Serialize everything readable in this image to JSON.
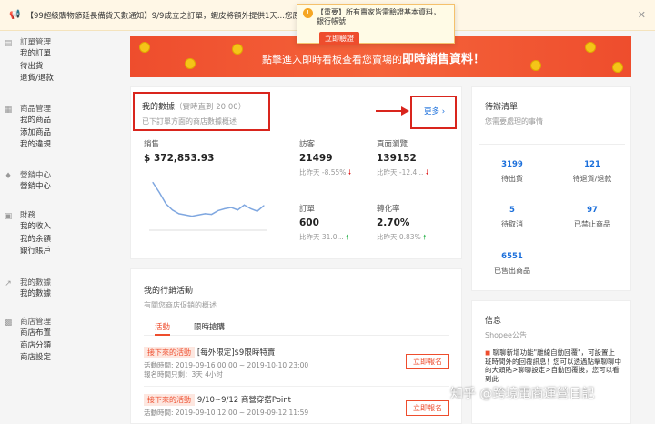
{
  "notice": {
    "text": "【99超級購物節延長備貨天數通知】9/9成立之訂單，蝦皮將額外提供1天...您原本的出貨期限皆會自動再延長1天..."
  },
  "popup": {
    "message": "【重要】所有賣家皆需驗證基本資料，銀行帳號",
    "button": "立即驗證"
  },
  "sidebar": {
    "groups": [
      {
        "icon": "clipboard-icon",
        "title": "訂單管理",
        "items": [
          "我的訂單",
          "待出貨",
          "退貨/退款"
        ]
      },
      {
        "icon": "bag-icon",
        "title": "商品管理",
        "items": [
          "我的商品",
          "添加商品",
          "我的違規"
        ]
      },
      {
        "icon": "tag-icon",
        "title": "營銷中心",
        "items": [
          "營銷中心"
        ]
      },
      {
        "icon": "wallet-icon",
        "title": "財務",
        "items": [
          "我的收入",
          "我的余額",
          "銀行賬戶"
        ]
      },
      {
        "icon": "chart-icon",
        "title": "我的數據",
        "items": [
          "我的數據"
        ]
      },
      {
        "icon": "shop-icon",
        "title": "商店管理",
        "items": [
          "商店布置",
          "商店分類",
          "商店設定"
        ]
      }
    ]
  },
  "banner": {
    "text_prefix": "點擊進入即時看板查看您賣場的",
    "text_bold": "即時銷售資料！"
  },
  "data_card": {
    "title": "我的數據",
    "realtime": "（實時直到 20:00）",
    "subtitle": "已下訂單方面的商店數據概述",
    "more": "更多",
    "sales_label": "銷售",
    "sales_value": "$ 372,853.93",
    "metrics": [
      {
        "label": "訪客",
        "value": "21499",
        "compare": "比昨天 -8.55%",
        "trend": "down"
      },
      {
        "label": "頁面瀏覽",
        "value": "139152",
        "compare": "比昨天 -12.4...",
        "trend": "down"
      },
      {
        "label": "訂單",
        "value": "600",
        "compare": "比昨天 31.0...",
        "trend": "up"
      },
      {
        "label": "轉化率",
        "value": "2.70%",
        "compare": "比昨天 0.83%",
        "trend": "up"
      }
    ]
  },
  "chart_data": {
    "type": "line",
    "title": "",
    "xlabel": "",
    "ylabel": "",
    "x": [
      0,
      1,
      2,
      3,
      4,
      5,
      6,
      7,
      8,
      9,
      10,
      11,
      12,
      13,
      14,
      15,
      16,
      17
    ],
    "series": [
      {
        "values": [
          72,
          56,
          38,
          28,
          22,
          20,
          18,
          20,
          22,
          21,
          27,
          30,
          32,
          28,
          36,
          30,
          26,
          35
        ]
      }
    ],
    "ylim": [
      0,
      80
    ],
    "grid": false,
    "color": "#7fa7e0"
  },
  "todo": {
    "title": "待辦清單",
    "subtitle": "您需要處理的事情",
    "items": [
      {
        "count": "3199",
        "label": "待出貨"
      },
      {
        "count": "121",
        "label": "待退貨/退款"
      },
      {
        "count": "5",
        "label": "待取消"
      },
      {
        "count": "97",
        "label": "已禁止商品"
      },
      {
        "count": "6551",
        "label": "已售出商品"
      }
    ]
  },
  "marketing": {
    "title": "我的行銷活動",
    "subtitle": "有關您商店促銷的概述",
    "tabs": [
      "活動",
      "限時搶購"
    ],
    "promos": [
      {
        "tag": "接下來的活動",
        "name": "[每外限定]$9限時特賣",
        "time": "活動時間: 2019-09-16 00:00 ~ 2019-10-10 23:00",
        "deadline": "報名時間只剩：3天 4小时",
        "button": "立即報名"
      },
      {
        "tag": "接下來的活動",
        "name": "9/10~9/12 商營穿搭Point",
        "time": "活動時間: 2019-09-10 12:00 ~ 2019-09-12 11:59",
        "deadline": "",
        "button": "立即報名"
      }
    ]
  },
  "info": {
    "title": "信息",
    "subtitle": "Shopee公告",
    "text": "聊聊新增功能\"離線自動回覆\"，可設置上班時間外的回覆訊息！您可以透過點擊聊聊中的大頭貼>聊聊設定>自動回覆後，您可以看到此"
  },
  "watermark": "知乎 @跨境電商運營日記",
  "colors": {
    "brand": "#ee4d2d",
    "link": "#1b6fdb",
    "annotation": "#d9251d"
  }
}
